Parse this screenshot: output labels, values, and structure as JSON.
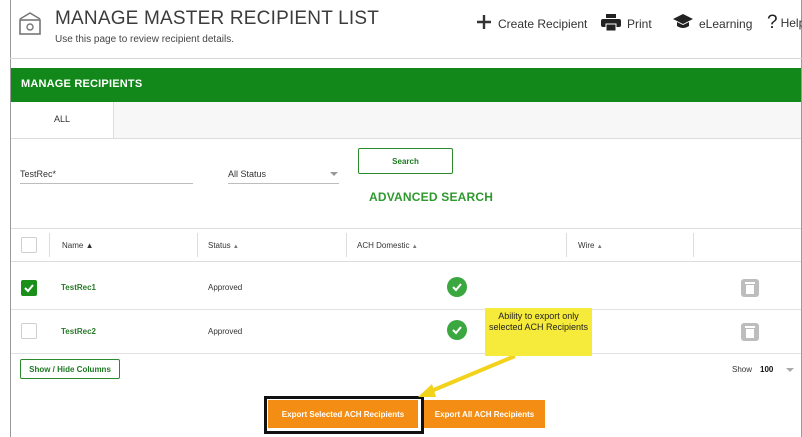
{
  "header": {
    "title": "MANAGE MASTER RECIPIENT LIST",
    "subtitle": "Use this page to review recipient details.",
    "tools": [
      {
        "label": "Create Recipient",
        "icon": "plus-icon"
      },
      {
        "label": "Print",
        "icon": "printer-icon"
      },
      {
        "label": "eLearning",
        "icon": "graduation-cap-icon"
      },
      {
        "label": "Help",
        "icon": "question-icon"
      }
    ]
  },
  "section": {
    "title": "MANAGE RECIPIENTS"
  },
  "tabs": [
    {
      "label": "ALL",
      "active": true
    }
  ],
  "search": {
    "query": "TestRec*",
    "status": "All Status",
    "button": "Search",
    "advanced": "ADVANCED SEARCH"
  },
  "table": {
    "columns": [
      "Name",
      "Status",
      "ACH Domestic",
      "Wire"
    ],
    "rows": [
      {
        "name": "TestRec1",
        "status": "Approved",
        "ach": "check-icon",
        "selected": true
      },
      {
        "name": "TestRec2",
        "status": "Approved",
        "ach": "check-icon",
        "selected": false
      }
    ]
  },
  "footer": {
    "show_hide": "Show / Hide Columns",
    "show_label": "Show",
    "show_value": "100",
    "export_selected": "Export Selected ACH Recipients",
    "export_all": "Export All ACH Recipients"
  },
  "callout": {
    "text": "Ability to export only selected ACH Recipients"
  },
  "colors": {
    "accent_green": "#12881a",
    "export_orange": "#f38d14",
    "callout_yellow": "#f6ea3a"
  }
}
